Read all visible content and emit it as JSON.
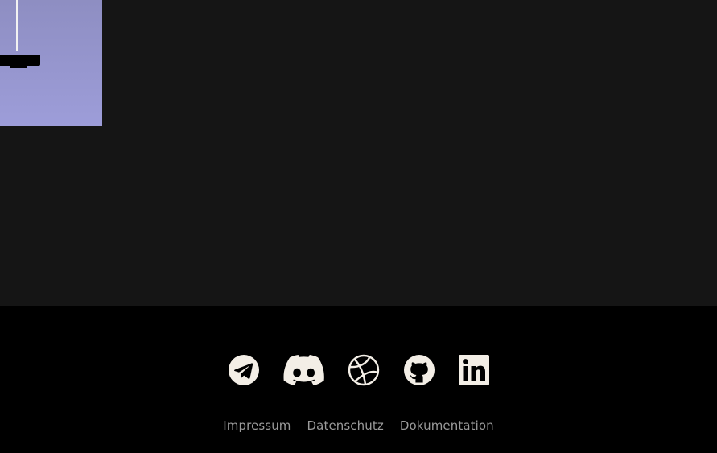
{
  "footer": {
    "social_links": [
      {
        "icon": "telegram-icon"
      },
      {
        "icon": "discord-icon"
      },
      {
        "icon": "dribbble-icon"
      },
      {
        "icon": "github-icon"
      },
      {
        "icon": "linkedin-icon"
      }
    ],
    "links": [
      {
        "label": "Impressum"
      },
      {
        "label": "Datenschutz"
      },
      {
        "label": "Dokumentation"
      }
    ]
  },
  "colors": {
    "content_background": "#151515",
    "footer_background": "#000000",
    "icon_color": "#f3eee6",
    "link_color": "#9a9a9a",
    "preview_tint": "#9d9dd9"
  }
}
